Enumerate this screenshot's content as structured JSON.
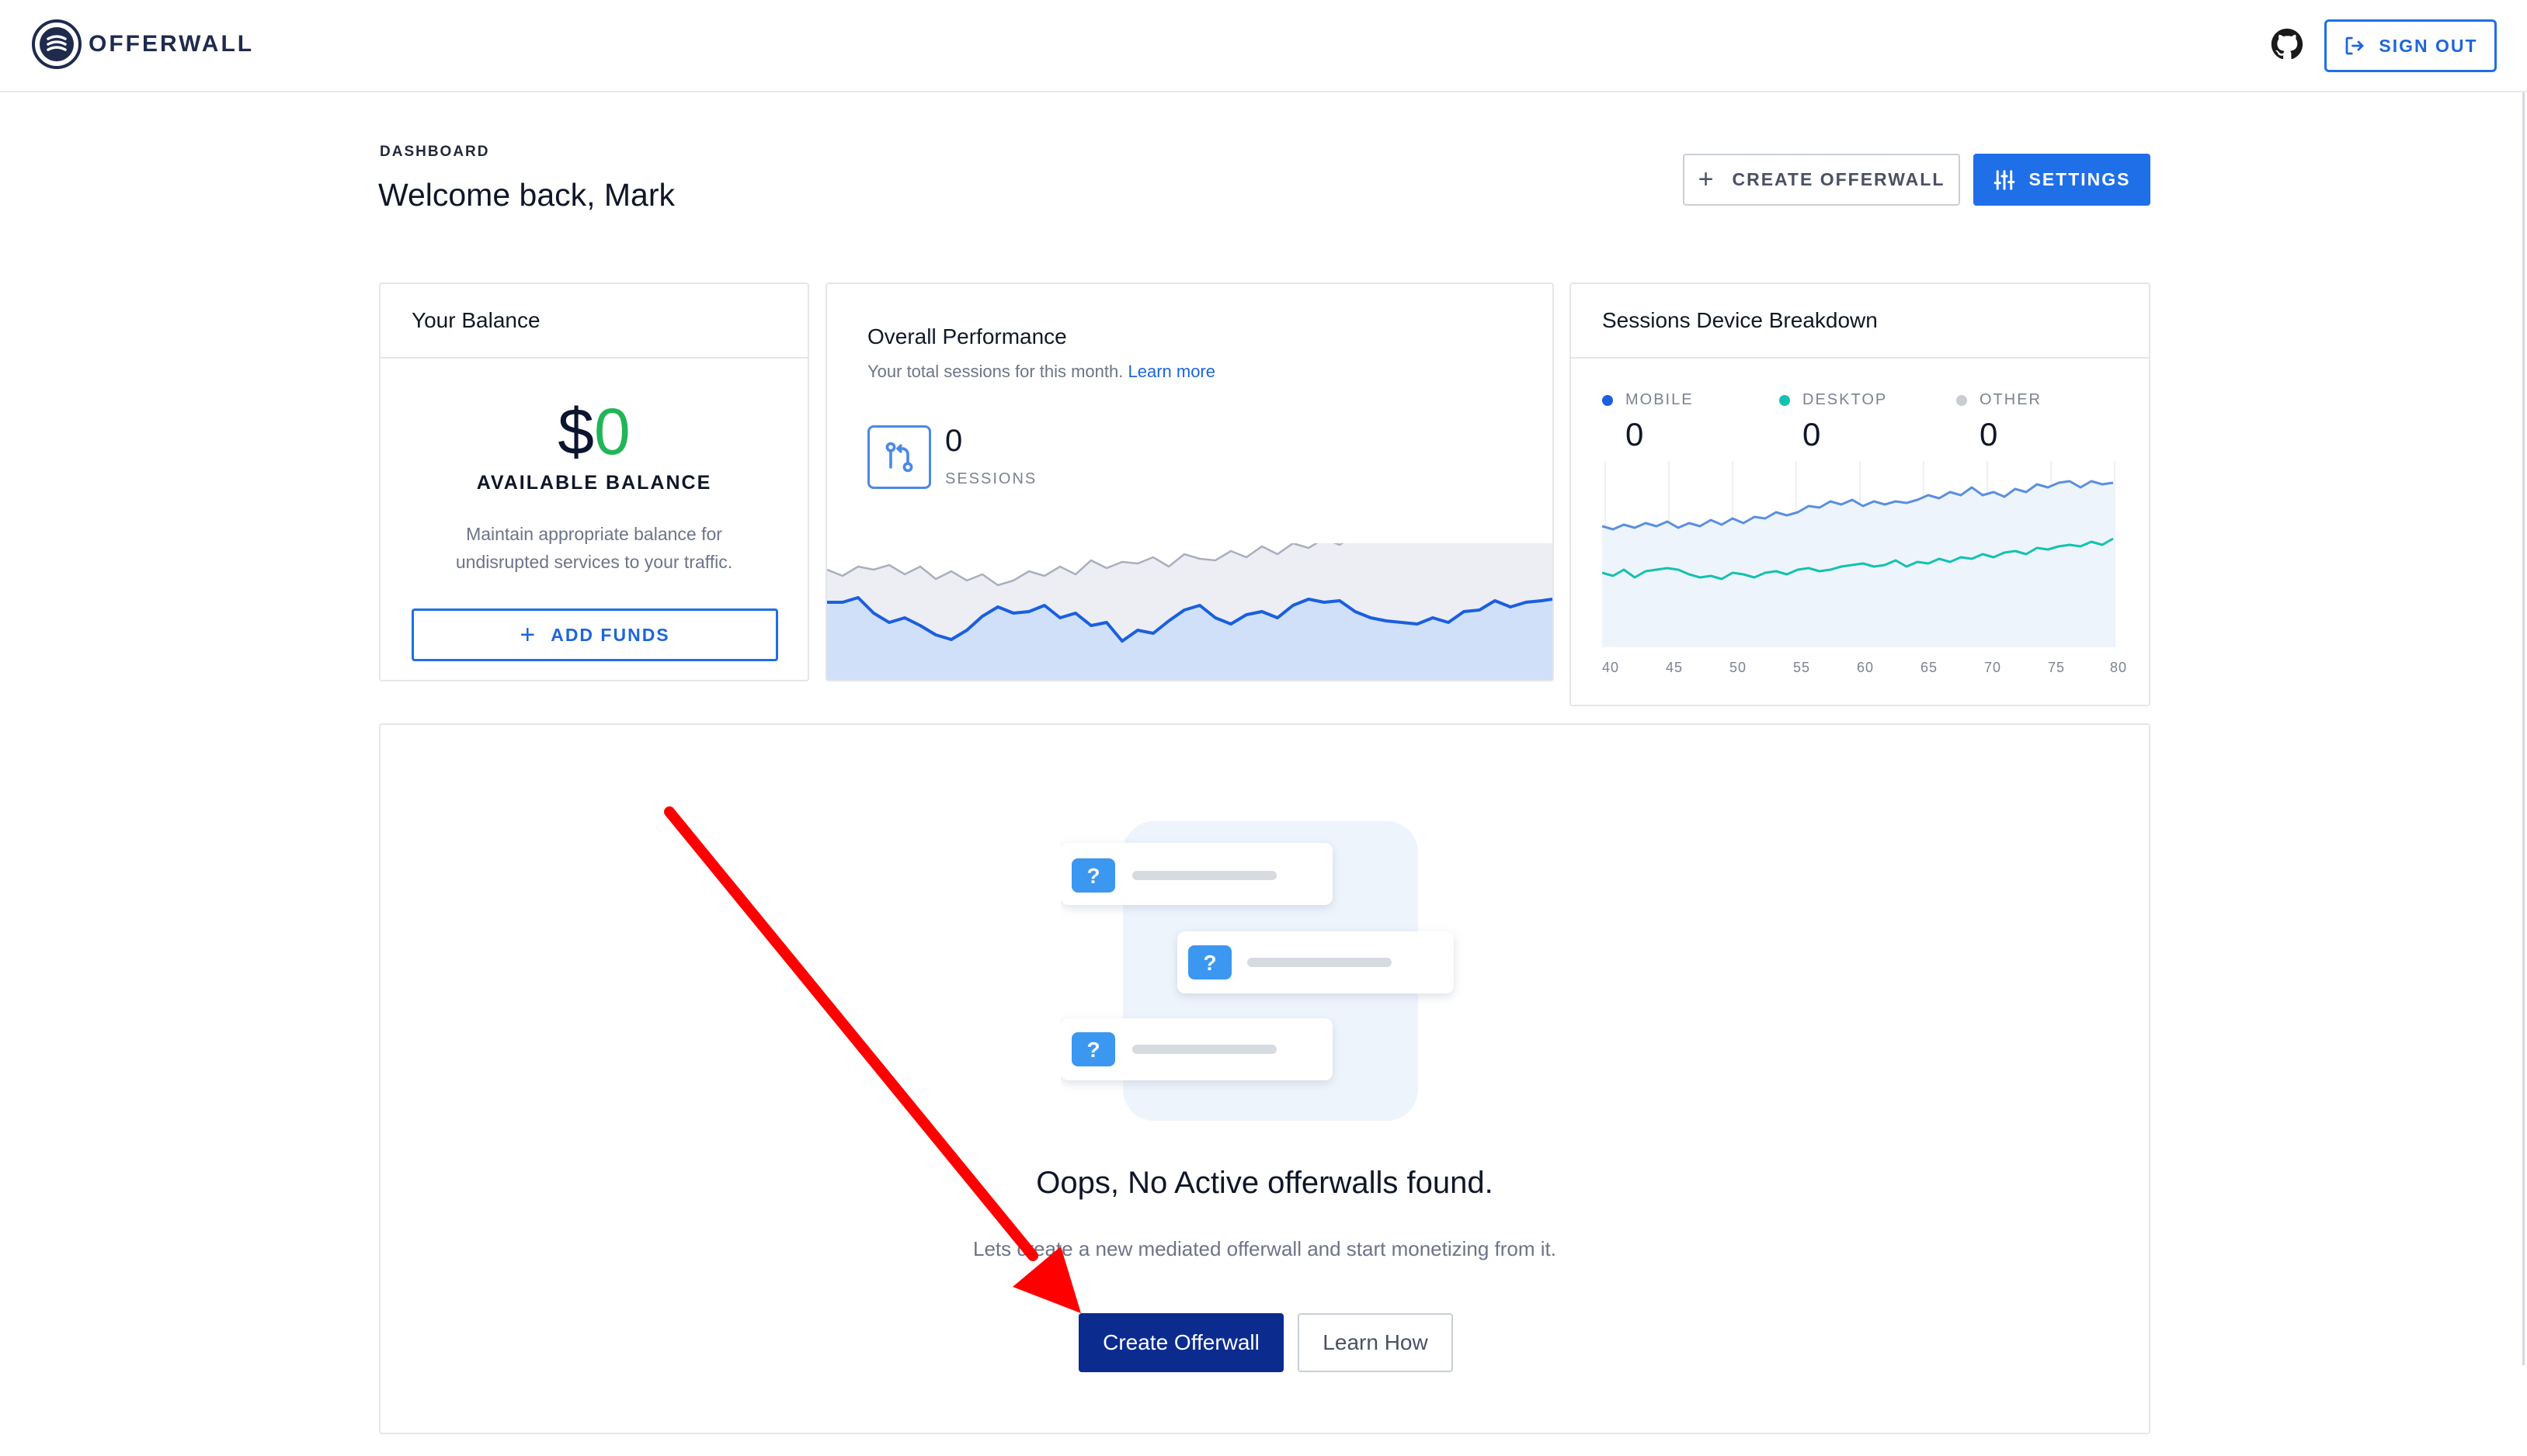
{
  "app": {
    "brand": "OFFERWALL"
  },
  "topbar": {
    "signout_label": "SIGN OUT",
    "github_icon": "github-icon",
    "signout_icon": "logout-icon"
  },
  "header": {
    "breadcrumb": "DASHBOARD",
    "welcome": "Welcome back, Mark",
    "create_label": "CREATE OFFERWALL",
    "settings_label": "SETTINGS"
  },
  "balance": {
    "title": "Your Balance",
    "currency": "$",
    "amount": "0",
    "label": "AVAILABLE BALANCE",
    "description": "Maintain appropriate balance for undisrupted services to your traffic.",
    "add_funds": "ADD FUNDS"
  },
  "performance": {
    "title": "Overall Performance",
    "subtitle": "Your total sessions for this month.",
    "learn_more": "Learn more",
    "sessions_value": "0",
    "sessions_label": "SESSIONS"
  },
  "devices": {
    "title": "Sessions Device Breakdown",
    "legend": [
      {
        "label": "MOBILE",
        "value": "0",
        "color": "#1a5fe0"
      },
      {
        "label": "DESKTOP",
        "value": "0",
        "color": "#12c2b0"
      },
      {
        "label": "OTHER",
        "value": "0",
        "color": "#c9ccd3"
      }
    ],
    "x_ticks": [
      "40",
      "45",
      "50",
      "55",
      "60",
      "65",
      "70",
      "75",
      "80"
    ]
  },
  "empty_state": {
    "title": "Oops, No Active offerwalls found.",
    "subtitle": "Lets create a new mediated offerwall and start monetizing from it.",
    "primary_button": "Create Offerwall",
    "secondary_button": "Learn How",
    "card_glyph": "?"
  },
  "colors": {
    "accent": "#1f6fe8",
    "primary_dark": "#0b2b8f",
    "success": "#21b557",
    "annotation_arrow": "#ff0000"
  }
}
